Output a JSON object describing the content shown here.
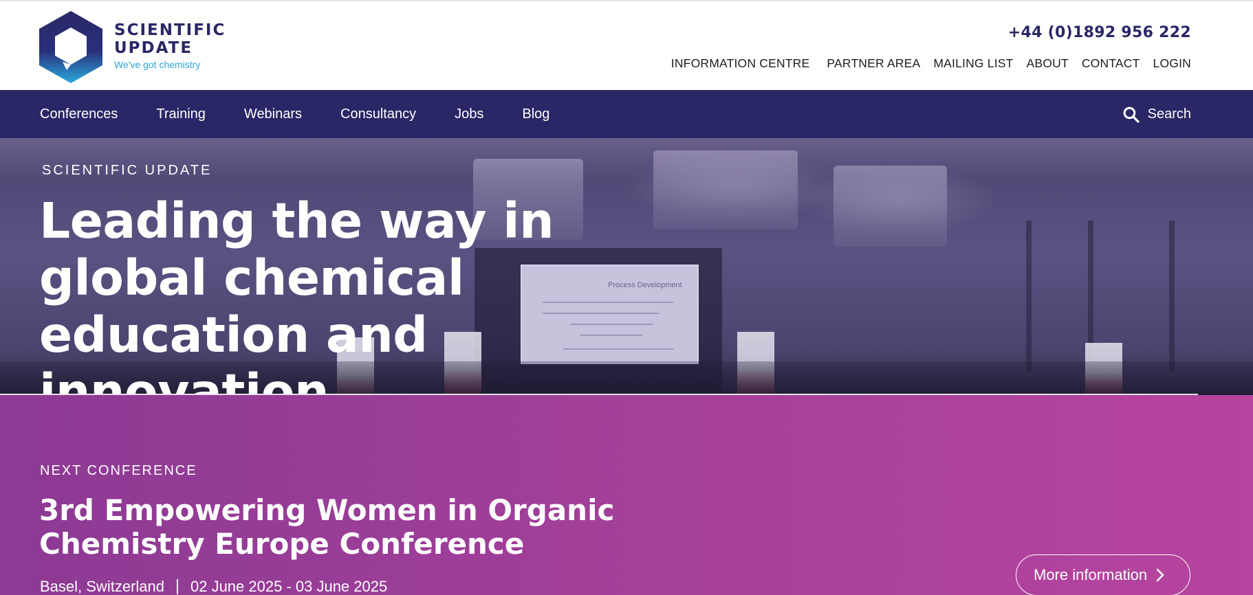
{
  "brand": {
    "name_line1": "SCIENTIFIC",
    "name_line2": "UPDATE",
    "tagline": "We've got chemistry",
    "colors": {
      "navy": "#2a2766",
      "cyan": "#2fa3d6",
      "magenta": "#b7449f"
    }
  },
  "header": {
    "phone": "+44 (0)1892 956 222",
    "utility_links": [
      "INFORMATION CENTRE",
      "PARTNER AREA",
      "MAILING LIST",
      "ABOUT",
      "CONTACT",
      "LOGIN"
    ]
  },
  "main_nav": {
    "items": [
      "Conferences",
      "Training",
      "Webinars",
      "Consultancy",
      "Jobs",
      "Blog"
    ],
    "search_label": "Search",
    "search_icon": "search-icon"
  },
  "hero": {
    "eyebrow": "SCIENTIFIC UPDATE",
    "title": "Leading the way in global chemical education and innovation",
    "screen_text": "Process Development"
  },
  "next_conference": {
    "eyebrow": "NEXT CONFERENCE",
    "title": "3rd Empowering Women in Organic Chemistry Europe Conference",
    "location": "Basel, Switzerland",
    "dates": "02 June 2025 - 03 June 2025",
    "button_label": "More information",
    "button_icon": "chevron-right-icon"
  }
}
